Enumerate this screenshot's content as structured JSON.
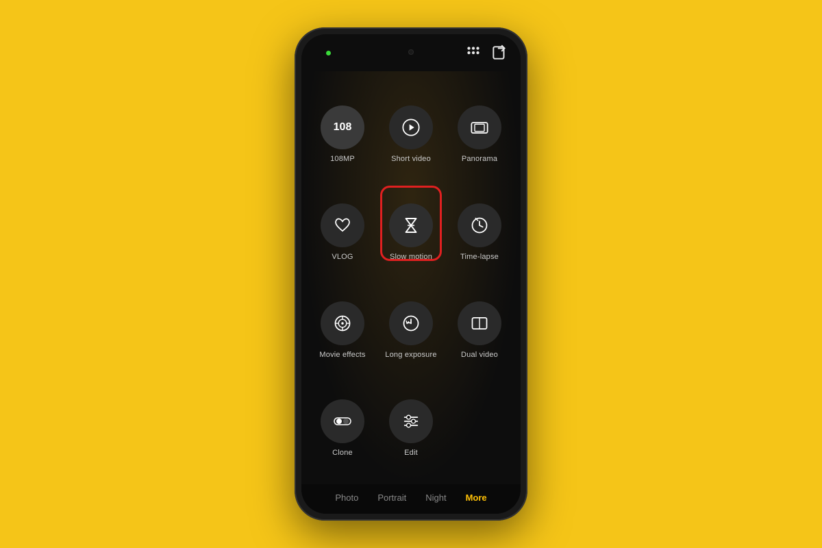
{
  "background_color": "#F5C518",
  "phone": {
    "indicator_dot_color": "#3adb3a",
    "top_icons": [
      {
        "name": "grid-icon",
        "symbol": "⠿"
      },
      {
        "name": "share-icon",
        "symbol": "⬡"
      }
    ]
  },
  "modes": [
    {
      "id": "108mp",
      "label": "108MP",
      "icon_type": "text",
      "icon_text": "108",
      "highlighted": false
    },
    {
      "id": "short-video",
      "label": "Short video",
      "icon_type": "play-circle",
      "highlighted": false
    },
    {
      "id": "panorama",
      "label": "Panorama",
      "icon_type": "panorama",
      "highlighted": false
    },
    {
      "id": "vlog",
      "label": "VLOG",
      "icon_type": "vlog",
      "highlighted": false
    },
    {
      "id": "slow-motion",
      "label": "Slow motion",
      "icon_type": "slow-motion",
      "highlighted": true
    },
    {
      "id": "time-lapse",
      "label": "Time-lapse",
      "icon_type": "time-lapse",
      "highlighted": false
    },
    {
      "id": "movie-effects",
      "label": "Movie effects",
      "icon_type": "movie-effects",
      "highlighted": false
    },
    {
      "id": "long-exposure",
      "label": "Long exposure",
      "icon_type": "long-exposure",
      "highlighted": false
    },
    {
      "id": "dual-video",
      "label": "Dual video",
      "icon_type": "dual-video",
      "highlighted": false
    },
    {
      "id": "clone",
      "label": "Clone",
      "icon_type": "clone",
      "highlighted": false
    },
    {
      "id": "edit",
      "label": "Edit",
      "icon_type": "edit",
      "highlighted": false
    }
  ],
  "nav": {
    "items": [
      {
        "id": "photo",
        "label": "Photo",
        "active": false
      },
      {
        "id": "portrait",
        "label": "Portrait",
        "active": false
      },
      {
        "id": "night",
        "label": "Night",
        "active": false
      },
      {
        "id": "more",
        "label": "More",
        "active": true
      }
    ]
  }
}
